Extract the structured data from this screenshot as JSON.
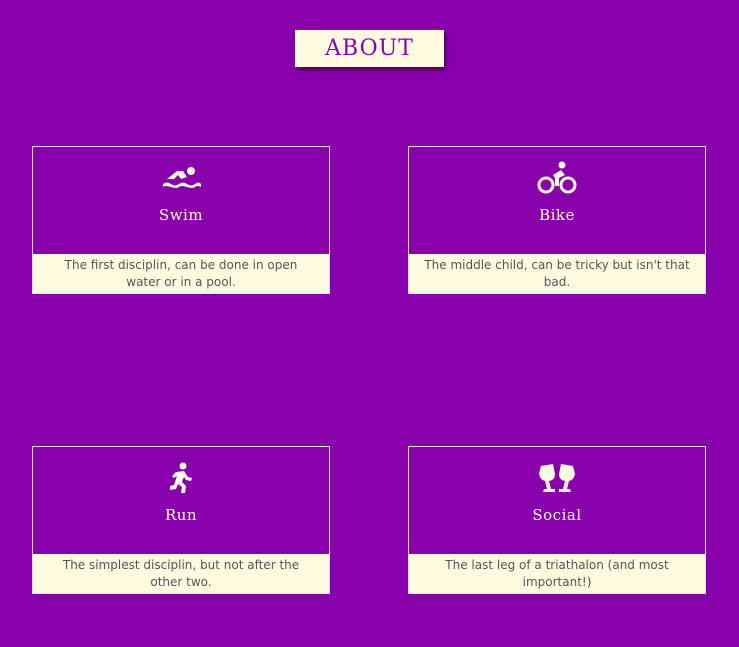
{
  "heading": "ABOUT",
  "cards": [
    {
      "title": "Swim",
      "icon": "swimmer-icon",
      "description": "The first disciplin, can be done in open water or in a pool."
    },
    {
      "title": "Bike",
      "icon": "biking-icon",
      "description": "The middle child, can be tricky but isn't that bad."
    },
    {
      "title": "Run",
      "icon": "running-icon",
      "description": "The simplest disciplin, but not after the other two."
    },
    {
      "title": "Social",
      "icon": "glass-cheers-icon",
      "description": "The last leg of a triathalon (and most important!)"
    }
  ],
  "colors": {
    "background": "#8800aa",
    "cream": "#fffbe0",
    "text": "#555555"
  }
}
